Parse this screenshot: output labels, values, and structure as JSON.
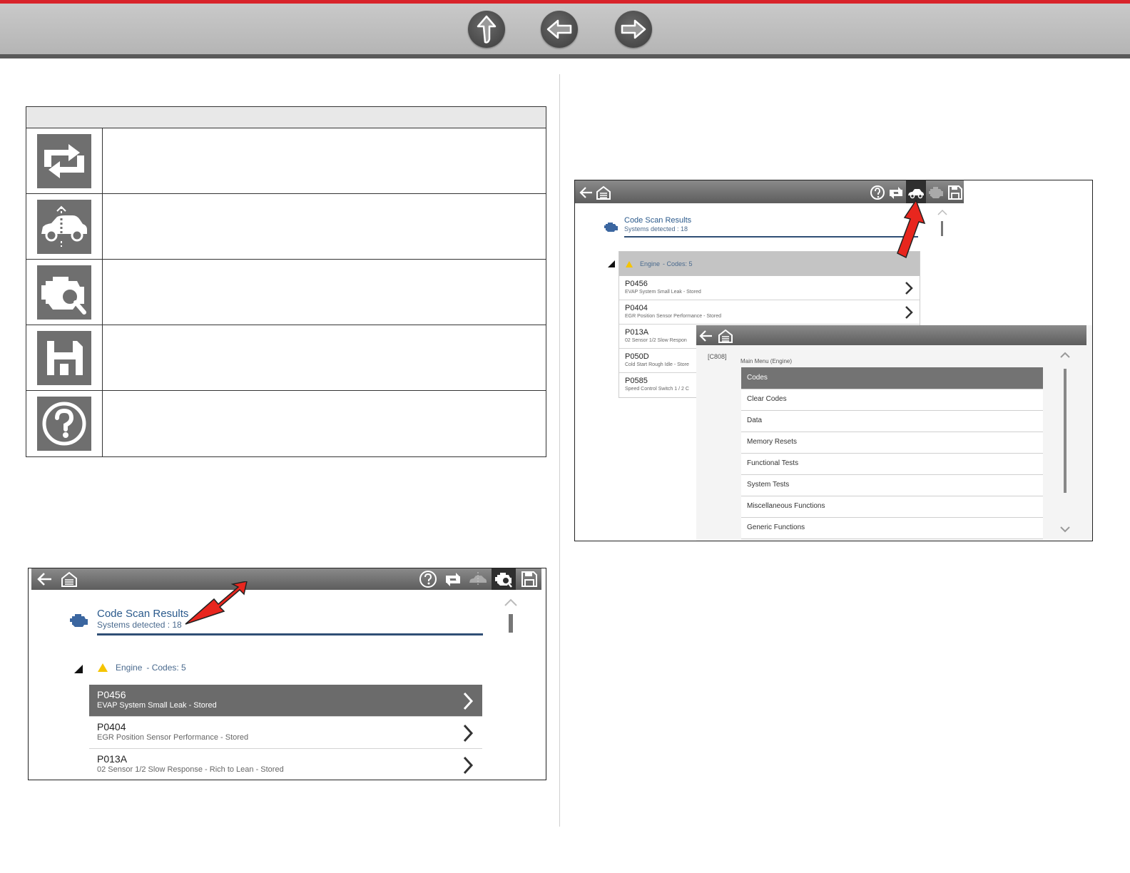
{
  "nav": {
    "buttons": [
      {
        "name": "up-arrow",
        "icon": "up-arrow-icon"
      },
      {
        "name": "back-arrow",
        "icon": "left-arrow-icon"
      },
      {
        "name": "forward-arrow",
        "icon": "right-arrow-icon"
      }
    ],
    "colors": {
      "accent": "#d8232a",
      "bar": "#bdbdbd"
    }
  },
  "icon_table": {
    "rows": [
      {
        "icon": "refresh-icon",
        "text": ""
      },
      {
        "icon": "vehicle-system-icon",
        "text": ""
      },
      {
        "icon": "engine-scan-icon",
        "text": ""
      },
      {
        "icon": "save-icon",
        "text": ""
      },
      {
        "icon": "help-icon",
        "text": ""
      }
    ]
  },
  "screen_a": {
    "toolbar_icons": [
      "back-icon",
      "home-icon",
      "help-icon",
      "refresh-icon",
      "vehicle-system-icon",
      "engine-scan-icon",
      "save-icon"
    ],
    "title": "Code Scan Results",
    "subtitle": "Systems detected : 18",
    "group": {
      "name": "Engine",
      "codes": "- Codes: 5"
    },
    "codes": [
      {
        "code": "P0456",
        "desc": "EVAP System Small Leak - Stored"
      },
      {
        "code": "P0404",
        "desc": "EGR Position Sensor Performance - Stored"
      },
      {
        "code": "P013A",
        "desc": "02 Sensor 1/2 Slow Response - Rich to Lean - Stored"
      }
    ]
  },
  "screen_b": {
    "title": "Code Scan Results",
    "subtitle": "Systems detected : 18",
    "group": {
      "name": "Engine",
      "codes": "- Codes: 5"
    },
    "codes": [
      {
        "code": "P0456",
        "desc": "EVAP System Small Leak - Stored"
      },
      {
        "code": "P0404",
        "desc": "EGR Position Sensor Performance - Stored"
      },
      {
        "code": "P013A",
        "desc": "02 Sensor 1/2 Slow Respon"
      },
      {
        "code": "P050D",
        "desc": "Cold Start Rough Idle - Store"
      },
      {
        "code": "P0585",
        "desc": "Speed Control Switch 1 / 2 C"
      }
    ],
    "overlay": {
      "tag": "[C808]",
      "menu_title": "Main Menu (Engine)",
      "items": [
        "Codes",
        "Clear Codes",
        "Data",
        "Memory Resets",
        "Functional Tests",
        "System Tests",
        "Miscellaneous Functions",
        "Generic Functions"
      ]
    }
  }
}
